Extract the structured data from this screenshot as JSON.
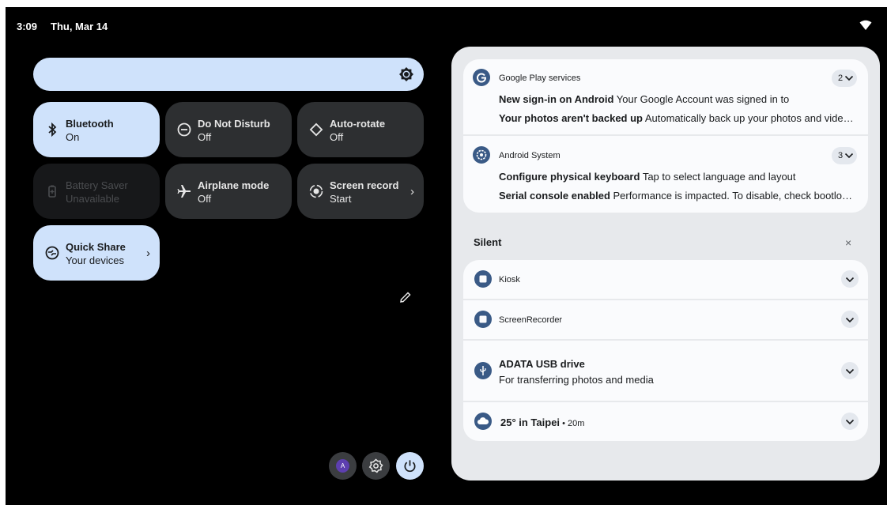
{
  "status": {
    "time": "3:09",
    "date": "Thu, Mar 14",
    "wifi_icon": "wifi-icon"
  },
  "brightness": {
    "icon": "brightness-icon"
  },
  "tiles": {
    "bluetooth": {
      "title": "Bluetooth",
      "state": "On"
    },
    "dnd": {
      "title": "Do Not Disturb",
      "state": "Off"
    },
    "autorotate": {
      "title": "Auto-rotate",
      "state": "Off"
    },
    "battery": {
      "title": "Battery Saver",
      "state": "Unavailable"
    },
    "airplane": {
      "title": "Airplane mode",
      "state": "Off"
    },
    "screenrecord": {
      "title": "Screen record",
      "state": "Start"
    },
    "quickshare": {
      "title": "Quick Share",
      "state": "Your devices"
    }
  },
  "footer": {
    "avatar_letter": "A"
  },
  "notifications": {
    "gps": {
      "app": "Google Play services",
      "count": "2",
      "line1_title": "New sign-in on Android",
      "line1_body": " Your Google Account was signed in to",
      "line2_title": "Your photos aren't backed up",
      "line2_body": " Automatically back up your photos and videos to Google Photos"
    },
    "android": {
      "app": "Android System",
      "count": "3",
      "line1_title": "Configure physical keyboard",
      "line1_body": " Tap to select language and layout",
      "line2_title": "Serial console enabled",
      "line2_body": " Performance is impacted. To disable, check bootloader."
    }
  },
  "silent": {
    "header": "Silent",
    "close": "×",
    "kiosk": "Kiosk",
    "screenrecorder": "ScreenRecorder",
    "usb_title": "ADATA USB drive",
    "usb_body": "For transferring photos and media",
    "weather_title": "25° in Taipei",
    "weather_sep": " • ",
    "weather_time": "20m"
  },
  "colors": {
    "accent": "#cfe2fb",
    "tile": "#2d2f31",
    "panel": "#e7e9ec",
    "card": "#fafbfd",
    "icon_bg": "#3a5a86"
  }
}
